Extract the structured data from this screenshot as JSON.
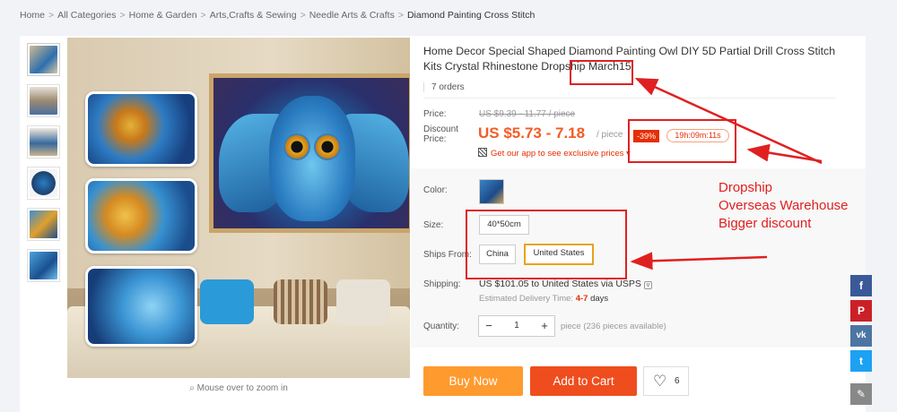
{
  "breadcrumb": {
    "items": [
      "Home",
      "All Categories",
      "Home & Garden",
      "Arts,Crafts & Sewing",
      "Needle Arts & Crafts"
    ],
    "current": "Diamond Painting Cross Stitch",
    "separator": ">"
  },
  "gallery": {
    "zoom_hint": "Mouse over to zoom in",
    "thumbnail_count": 6
  },
  "product": {
    "title": "Home Decor Special Shaped Diamond Painting Owl DIY 5D Partial Drill Cross Stitch Kits Crystal Rhinestone Dropship March15",
    "orders": "7 orders"
  },
  "pricing": {
    "price_label": "Price:",
    "original_price": "US $9.39 - 11.77 / piece",
    "discount_label_1": "Discount",
    "discount_label_2": "Price:",
    "discount_price": "US $5.73 - 7.18",
    "unit": "/ piece",
    "discount_badge": "-39%",
    "countdown": "19h:09m:11s",
    "app_promo": "Get our app to see exclusive prices",
    "app_promo_chevron": "▾"
  },
  "options": {
    "color_label": "Color:",
    "size_label": "Size:",
    "size_value": "40*50cm",
    "ships_from_label": "Ships From:",
    "ships_from_options": [
      "China",
      "United States"
    ],
    "ships_from_selected": "United States"
  },
  "shipping": {
    "label": "Shipping:",
    "value": "US $101.05 to United States via USPS",
    "chevron": "v",
    "delivery_prefix": "Estimated Delivery Time:",
    "delivery_days": "4-7",
    "delivery_unit": "days"
  },
  "quantity": {
    "label": "Quantity:",
    "minus": "−",
    "value": "1",
    "plus": "+",
    "available": "piece (236 pieces available)"
  },
  "actions": {
    "buy_now": "Buy Now",
    "add_to_cart": "Add to Cart",
    "wishlist_heart": "♡",
    "wishlist_count": "6"
  },
  "social": {
    "facebook": "f",
    "pinterest": "P",
    "vk": "vk",
    "twitter": "t",
    "edit": "✎"
  },
  "annotation": {
    "lines": [
      "Dropship",
      "Overseas Warehouse",
      "Bigger discount"
    ]
  },
  "colors": {
    "accent": "#f45b27",
    "buy_now": "#ff9a2e",
    "add_to_cart": "#f04d1e",
    "annotation": "#e02020",
    "selected_option": "#e8a31e"
  }
}
